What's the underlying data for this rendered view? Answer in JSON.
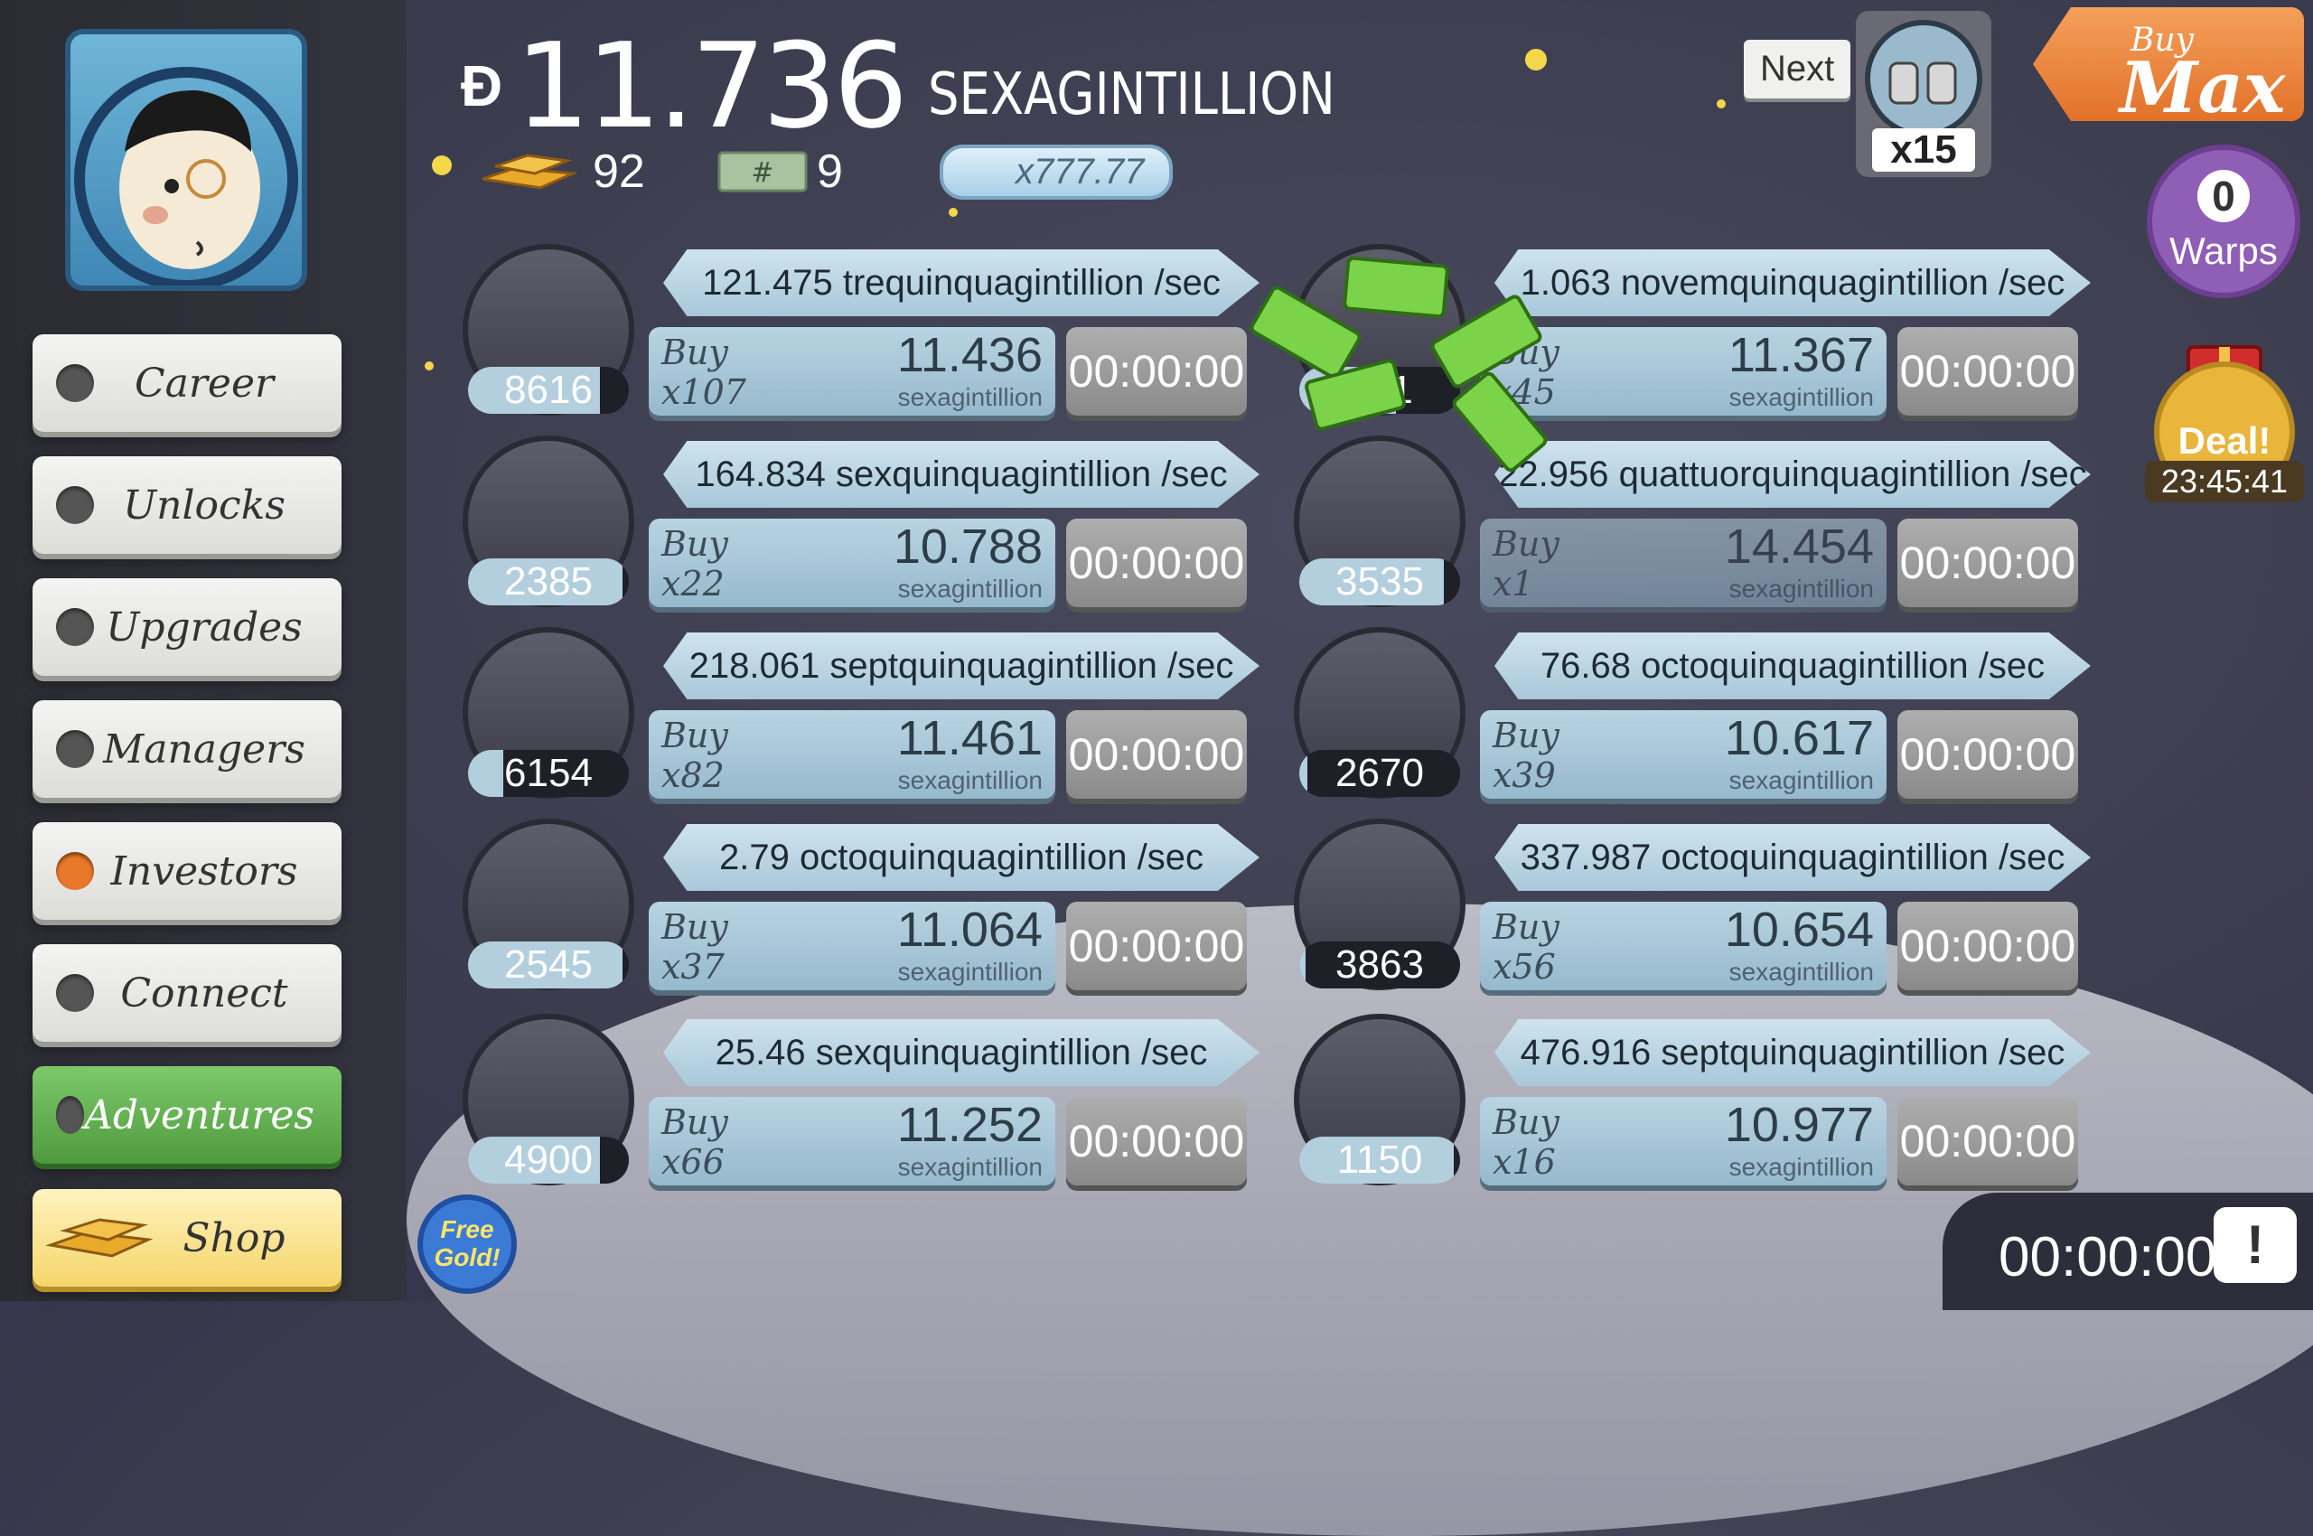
{
  "sidebar": {
    "items": [
      {
        "label": "Career",
        "state": "normal"
      },
      {
        "label": "Unlocks",
        "state": "normal"
      },
      {
        "label": "Upgrades",
        "state": "normal"
      },
      {
        "label": "Managers",
        "state": "normal"
      },
      {
        "label": "Investors",
        "state": "alert"
      },
      {
        "label": "Connect",
        "state": "normal"
      },
      {
        "label": "Adventures",
        "state": "active"
      },
      {
        "label": "Shop",
        "state": "shop"
      }
    ]
  },
  "header": {
    "money_symbol": "Ð",
    "money_value": "11.736",
    "money_unit": "SEXAGINTILLION",
    "gold_count": "92",
    "tickets_count": "9",
    "angel_multiplier": "x777.77"
  },
  "next_unlock": {
    "label": "Next",
    "multiplier": "x15",
    "icon": "boots-icon"
  },
  "buy_max": {
    "buy": "Buy",
    "max": "Max"
  },
  "warps": {
    "count": "0",
    "label": "Warps"
  },
  "deal": {
    "label": "Deal!",
    "timer": "23:45:41"
  },
  "businesses": [
    {
      "icon": "boots-icon",
      "owned": "8616",
      "progress": 0.82,
      "rate": "121.475 trequinquagintillion /sec",
      "buy_label": "Buy",
      "buy_qty": "x107",
      "cost": "11.436",
      "cost_unit": "sexagintillion",
      "timer": "00:00:00"
    },
    {
      "icon": "purple-orb-icon",
      "owned": "321",
      "progress": 0.6,
      "rate": "1.063 novemquinquagintillion /sec",
      "buy_label": "Buy",
      "buy_qty": "x45",
      "cost": "11.367",
      "cost_unit": "sexagintillion",
      "timer": "00:00:00"
    },
    {
      "icon": "phone-booth-icon",
      "owned": "2385",
      "progress": 0.96,
      "rate": "164.834 sexquinquagintillion /sec",
      "buy_label": "Buy",
      "buy_qty": "x22",
      "cost": "10.788",
      "cost_unit": "sexagintillion",
      "timer": "00:00:00"
    },
    {
      "icon": "cheese-cart-icon",
      "owned": "3535",
      "progress": 0.9,
      "rate": "22.956 quattuorquinquagintillion /sec",
      "buy_label": "Buy",
      "buy_qty": "x1",
      "cost": "14.454",
      "cost_unit": "sexagintillion",
      "timer": "00:00:00",
      "dim": true
    },
    {
      "icon": "podium-icon",
      "owned": "6154",
      "progress": 0.22,
      "rate": "218.061 septquinquagintillion /sec",
      "buy_label": "Buy",
      "buy_qty": "x82",
      "cost": "11.461",
      "cost_unit": "sexagintillion",
      "timer": "00:00:00"
    },
    {
      "icon": "rollercoaster-icon",
      "owned": "2670",
      "progress": 0.05,
      "rate": "76.68 octoquinquagintillion /sec",
      "buy_label": "Buy",
      "buy_qty": "x39",
      "cost": "10.617",
      "cost_unit": "sexagintillion",
      "timer": "00:00:00"
    },
    {
      "icon": "moon-rocket-icon",
      "owned": "2545",
      "progress": 0.96,
      "rate": "2.79 octoquinquagintillion /sec",
      "buy_label": "Buy",
      "buy_qty": "x37",
      "cost": "11.064",
      "cost_unit": "sexagintillion",
      "timer": "00:00:00"
    },
    {
      "icon": "werewolf-icon",
      "owned": "3863",
      "progress": 0.04,
      "rate": "337.987 octoquinquagintillion /sec",
      "buy_label": "Buy",
      "buy_qty": "x56",
      "cost": "10.654",
      "cost_unit": "sexagintillion",
      "timer": "00:00:00"
    },
    {
      "icon": "cocktail-icon",
      "owned": "4900",
      "progress": 0.82,
      "rate": "25.46 sexquinquagintillion /sec",
      "buy_label": "Buy",
      "buy_qty": "x66",
      "cost": "11.252",
      "cost_unit": "sexagintillion",
      "timer": "00:00:00"
    },
    {
      "icon": "ray-gun-icon",
      "owned": "1150",
      "progress": 0.96,
      "rate": "476.916 septquinquagintillion /sec",
      "buy_label": "Buy",
      "buy_qty": "x16",
      "cost": "10.977",
      "cost_unit": "sexagintillion",
      "timer": "00:00:00"
    }
  ],
  "free_gold": {
    "label": "Free Gold!"
  },
  "bottom": {
    "timer": "00:00:00",
    "tv_icon": "tv-alert-icon"
  }
}
